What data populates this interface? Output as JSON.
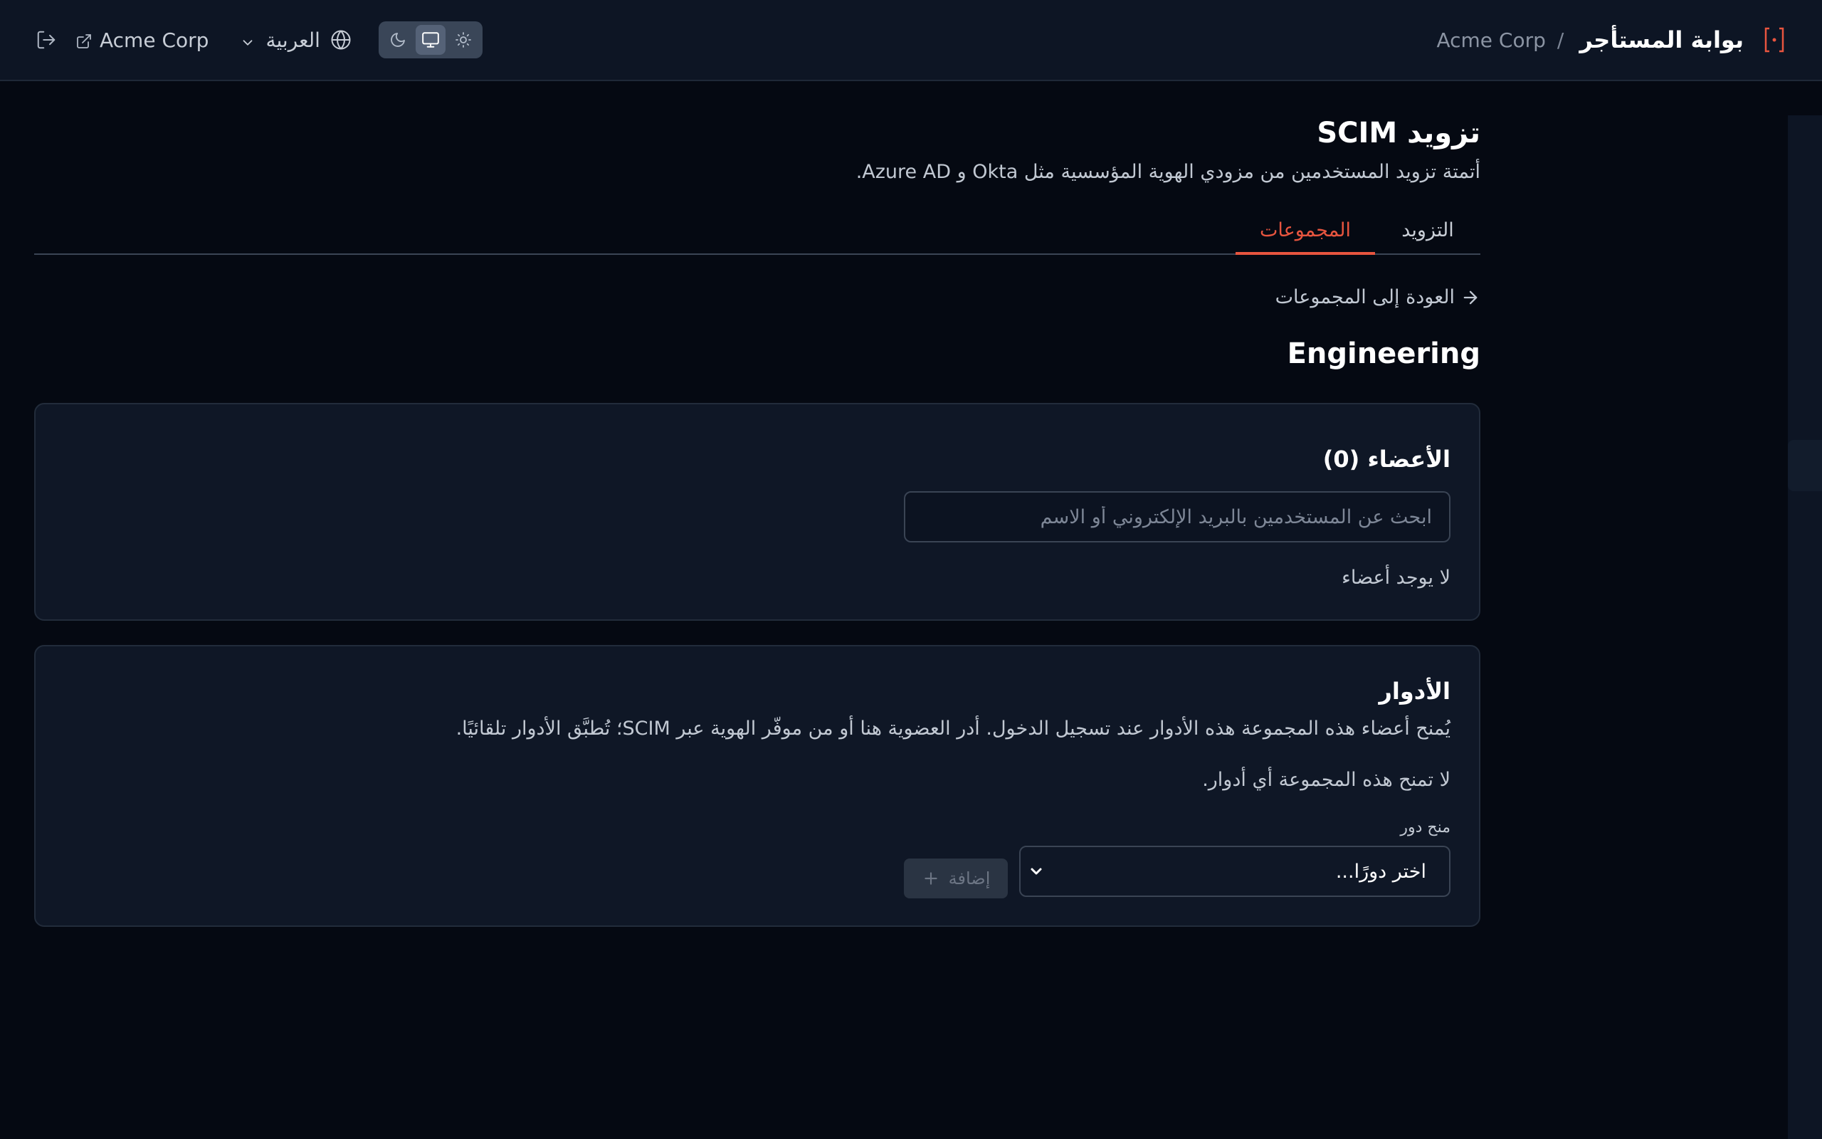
{
  "header": {
    "app_title": "بوابة المستأجر",
    "separator": "/",
    "tenant_name": "Acme Corp",
    "tenant_link_label": "Acme Corp",
    "language_label": "العربية",
    "theme_options": [
      "dark",
      "system",
      "light"
    ],
    "theme_selected": "system",
    "icons": [
      "brand-bracket-icon",
      "logout-icon",
      "external-link-icon",
      "chevron-down-icon",
      "globe-icon",
      "moon-icon",
      "monitor-icon",
      "sun-icon"
    ]
  },
  "page": {
    "title": "تزويد SCIM",
    "subtitle": "أتمتة تزويد المستخدمين من مزودي الهوية المؤسسية مثل Okta و Azure AD."
  },
  "tabs": [
    {
      "label": "التزويد",
      "active": false
    },
    {
      "label": "المجموعات",
      "active": true
    }
  ],
  "back_link": "العودة إلى المجموعات",
  "group": {
    "name": "Engineering"
  },
  "members": {
    "title": "الأعضاء (0)",
    "search_placeholder": "ابحث عن المستخدمين بالبريد الإلكتروني أو الاسم",
    "empty_text": "لا يوجد أعضاء"
  },
  "roles": {
    "title": "الأدوار",
    "description": "يُمنح أعضاء هذه المجموعة هذه الأدوار عند تسجيل الدخول. أدر العضوية هنا أو من موفّر الهوية عبر SCIM؛ تُطبَّق الأدوار تلقائيًا.",
    "empty_text": "لا تمنح هذه المجموعة أي أدوار.",
    "grant_label": "منح دور",
    "select_value": "اختر دورًا...",
    "add_button": "إضافة"
  },
  "colors": {
    "accent": "#e8553f",
    "background": "#050912",
    "header_bg": "#0d1524",
    "card_bg": "#0f1726"
  }
}
